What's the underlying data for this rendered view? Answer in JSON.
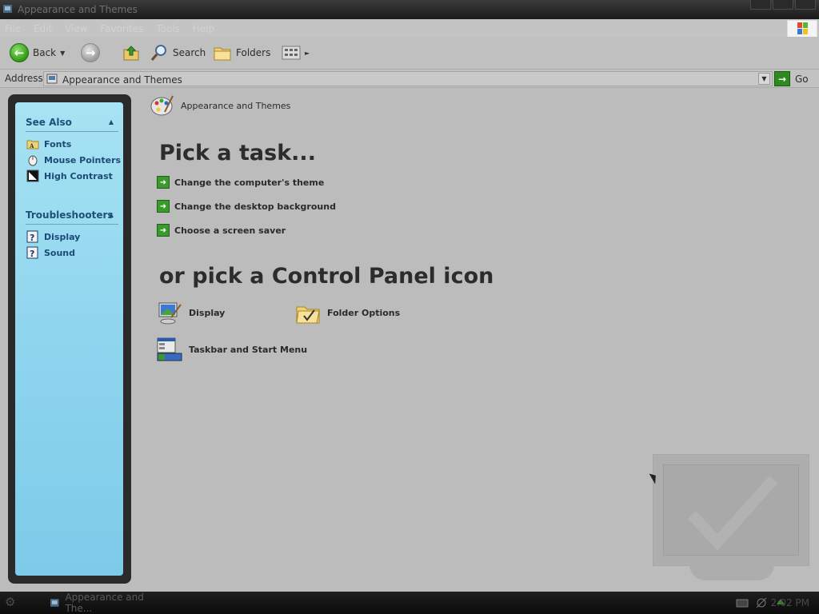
{
  "window": {
    "title": "Appearance and Themes"
  },
  "menubar": {
    "items": [
      "File",
      "Edit",
      "View",
      "Favorites",
      "Tools",
      "Help"
    ]
  },
  "toolbar": {
    "back_label": "Back",
    "search_label": "Search",
    "folders_label": "Folders"
  },
  "address": {
    "label": "Address",
    "value": "Appearance and Themes",
    "go_label": "Go"
  },
  "sidebar": {
    "see_also": {
      "title": "See Also",
      "items": [
        {
          "label": "Fonts",
          "icon": "folder-fonts-icon"
        },
        {
          "label": "Mouse Pointers",
          "icon": "mouse-icon"
        },
        {
          "label": "High Contrast",
          "icon": "contrast-icon"
        }
      ]
    },
    "troubleshooters": {
      "title": "Troubleshooters",
      "items": [
        {
          "label": "Display",
          "icon": "help-icon"
        },
        {
          "label": "Sound",
          "icon": "help-icon"
        }
      ]
    }
  },
  "main": {
    "category_title": "Appearance and Themes",
    "pick_task_heading": "Pick a task...",
    "tasks": [
      "Change the computer's theme",
      "Change the desktop background",
      "Choose a screen saver"
    ],
    "pick_icon_heading": "or pick a Control Panel icon",
    "icons": [
      {
        "label": "Display",
        "icon": "display-icon"
      },
      {
        "label": "Folder Options",
        "icon": "folder-options-icon"
      },
      {
        "label": "Taskbar and Start Menu",
        "icon": "taskbar-icon"
      }
    ]
  },
  "taskbar": {
    "window_button": "Appearance and The...",
    "clock": "2:02 PM"
  },
  "colors": {
    "accent_green": "#2f9b14",
    "sidebar_blue": "#8fd5ee",
    "sidebar_link": "#1b4a75"
  }
}
